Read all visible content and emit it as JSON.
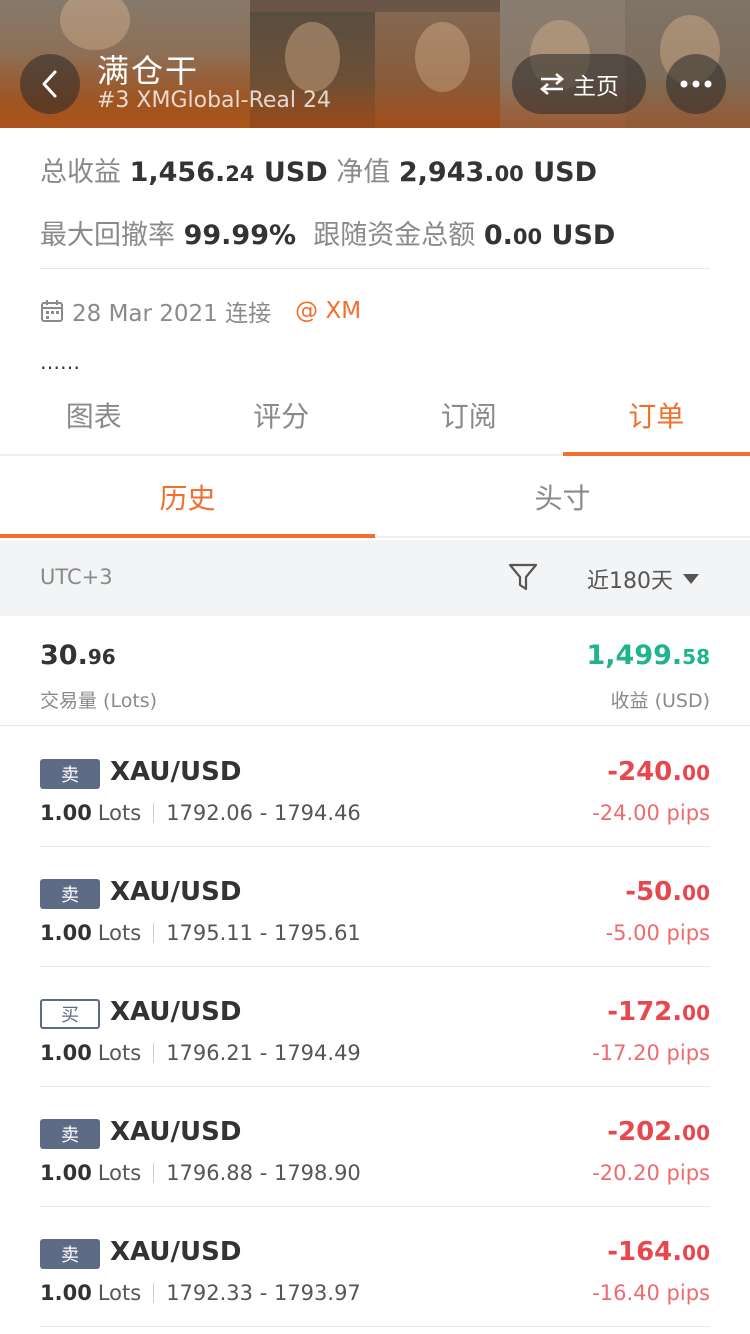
{
  "header": {
    "title": "满仓干",
    "subtitle": "#3 XMGlobal-Real 24",
    "home_label": "主页"
  },
  "stats": {
    "total_profit_label": "总收益",
    "total_profit_int": "1,456.",
    "total_profit_dec": "24",
    "total_profit_unit": "USD",
    "equity_label": "净值",
    "equity_int": "2,943.",
    "equity_dec": "00",
    "equity_unit": "USD",
    "max_drawdown_label": "最大回撤率",
    "max_drawdown_value": "99.99%",
    "follow_total_label": "跟随资金总额",
    "follow_total_int": "0.",
    "follow_total_dec": "00",
    "follow_total_unit": "USD"
  },
  "connection": {
    "date_text": "28 Mar 2021 连接",
    "broker": "@ XM"
  },
  "description": "……",
  "tabs": [
    {
      "label": "图表"
    },
    {
      "label": "评分"
    },
    {
      "label": "订阅"
    },
    {
      "label": "订单",
      "active": true
    }
  ],
  "subtabs": [
    {
      "label": "历史",
      "active": true
    },
    {
      "label": "头寸"
    }
  ],
  "filter": {
    "timezone": "UTC+3",
    "period": "近180天"
  },
  "summary": {
    "lots_int": "30.",
    "lots_dec": "96",
    "lots_label": "交易量 (Lots)",
    "profit_int": "1,499.",
    "profit_dec": "58",
    "profit_label": "收益 (USD)"
  },
  "orders": [
    {
      "side": "卖",
      "type": "sell",
      "symbol": "XAU/USD",
      "lots": "1.00",
      "lots_unit": "Lots",
      "range": "1792.06 - 1794.46",
      "profit_int": "-240.",
      "profit_dec": "00",
      "pips": "-24.00 pips"
    },
    {
      "side": "卖",
      "type": "sell",
      "symbol": "XAU/USD",
      "lots": "1.00",
      "lots_unit": "Lots",
      "range": "1795.11 - 1795.61",
      "profit_int": "-50.",
      "profit_dec": "00",
      "pips": "-5.00 pips"
    },
    {
      "side": "买",
      "type": "buy",
      "symbol": "XAU/USD",
      "lots": "1.00",
      "lots_unit": "Lots",
      "range": "1796.21 - 1794.49",
      "profit_int": "-172.",
      "profit_dec": "00",
      "pips": "-17.20 pips"
    },
    {
      "side": "卖",
      "type": "sell",
      "symbol": "XAU/USD",
      "lots": "1.00",
      "lots_unit": "Lots",
      "range": "1796.88 - 1798.90",
      "profit_int": "-202.",
      "profit_dec": "00",
      "pips": "-20.20 pips"
    },
    {
      "side": "卖",
      "type": "sell",
      "symbol": "XAU/USD",
      "lots": "1.00",
      "lots_unit": "Lots",
      "range": "1792.33 - 1793.97",
      "profit_int": "-164.",
      "profit_dec": "00",
      "pips": "-16.40 pips"
    }
  ],
  "colors": {
    "accent": "#f26f2c",
    "profit_positive": "#1fb38e",
    "profit_negative": "#e8474e",
    "badge": "#5d6b87"
  }
}
